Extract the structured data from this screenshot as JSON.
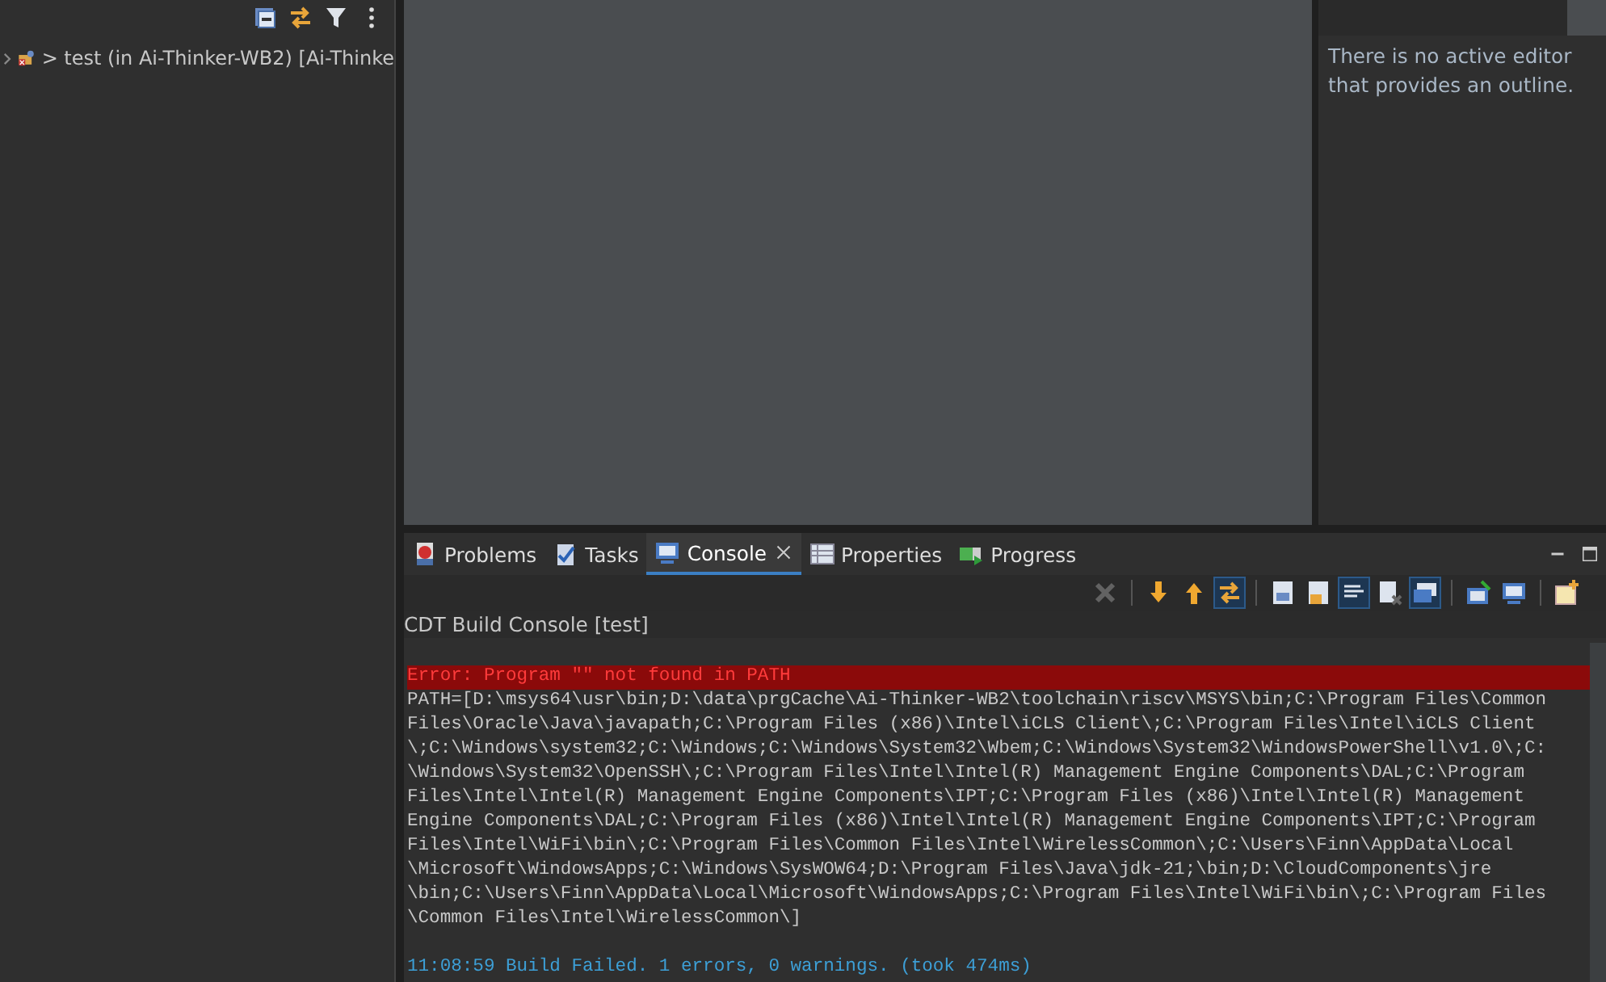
{
  "project_explorer": {
    "items": [
      {
        "label": "> test (in Ai-Thinker-WB2) [Ai-Thinke",
        "expanded": false
      }
    ]
  },
  "outline": {
    "message": "There is no active editor that provides an outline."
  },
  "console_panel": {
    "tabs": [
      {
        "label": "Problems",
        "selected": false
      },
      {
        "label": "Tasks",
        "selected": false
      },
      {
        "label": "Console",
        "selected": true,
        "closable": true
      },
      {
        "label": "Properties",
        "selected": false
      },
      {
        "label": "Progress",
        "selected": false
      }
    ],
    "toolbar_buttons": [
      {
        "pressed": false,
        "disabled": true
      },
      {
        "pressed": false,
        "disabled": false
      },
      {
        "pressed": false,
        "disabled": false
      },
      {
        "pressed": true,
        "disabled": false
      },
      {
        "pressed": false,
        "disabled": false
      },
      {
        "pressed": false,
        "disabled": false
      },
      {
        "pressed": true,
        "disabled": false
      },
      {
        "pressed": false,
        "disabled": false
      },
      {
        "pressed": true,
        "disabled": false
      },
      {
        "pressed": false,
        "disabled": false
      },
      {
        "pressed": false,
        "disabled": false
      },
      {
        "pressed": false,
        "disabled": false
      }
    ],
    "console_title": "CDT Build Console [test]",
    "lines": [
      {
        "kind": "error",
        "text": "Error: Program \"\" not found in PATH"
      },
      {
        "kind": "output",
        "text": "PATH=[D:\\msys64\\usr\\bin;D:\\data\\prgCache\\Ai-Thinker-WB2\\toolchain\\riscv\\MSYS\\bin;C:\\Program Files\\Common"
      },
      {
        "kind": "output",
        "text": "Files\\Oracle\\Java\\javapath;C:\\Program Files (x86)\\Intel\\iCLS Client\\;C:\\Program Files\\Intel\\iCLS Client"
      },
      {
        "kind": "output",
        "text": "\\;C:\\Windows\\system32;C:\\Windows;C:\\Windows\\System32\\Wbem;C:\\Windows\\System32\\WindowsPowerShell\\v1.0\\;C:"
      },
      {
        "kind": "output",
        "text": "\\Windows\\System32\\OpenSSH\\;C:\\Program Files\\Intel\\Intel(R) Management Engine Components\\DAL;C:\\Program"
      },
      {
        "kind": "output",
        "text": "Files\\Intel\\Intel(R) Management Engine Components\\IPT;C:\\Program Files (x86)\\Intel\\Intel(R) Management"
      },
      {
        "kind": "output",
        "text": "Engine Components\\DAL;C:\\Program Files (x86)\\Intel\\Intel(R) Management Engine Components\\IPT;C:\\Program"
      },
      {
        "kind": "output",
        "text": "Files\\Intel\\WiFi\\bin\\;C:\\Program Files\\Common Files\\Intel\\WirelessCommon\\;C:\\Users\\Finn\\AppData\\Local"
      },
      {
        "kind": "output",
        "text": "\\Microsoft\\WindowsApps;C:\\Windows\\SysWOW64;D:\\Program Files\\Java\\jdk-21;\\bin;D:\\CloudComponents\\jre"
      },
      {
        "kind": "output",
        "text": "\\bin;C:\\Users\\Finn\\AppData\\Local\\Microsoft\\WindowsApps;C:\\Program Files\\Intel\\WiFi\\bin\\;C:\\Program Files"
      },
      {
        "kind": "output",
        "text": "\\Common Files\\Intel\\WirelessCommon\\]"
      },
      {
        "kind": "blank"
      },
      {
        "kind": "info",
        "text": "11:08:59 Build Failed. 1 errors, 0 warnings. (took 474ms)"
      }
    ]
  }
}
